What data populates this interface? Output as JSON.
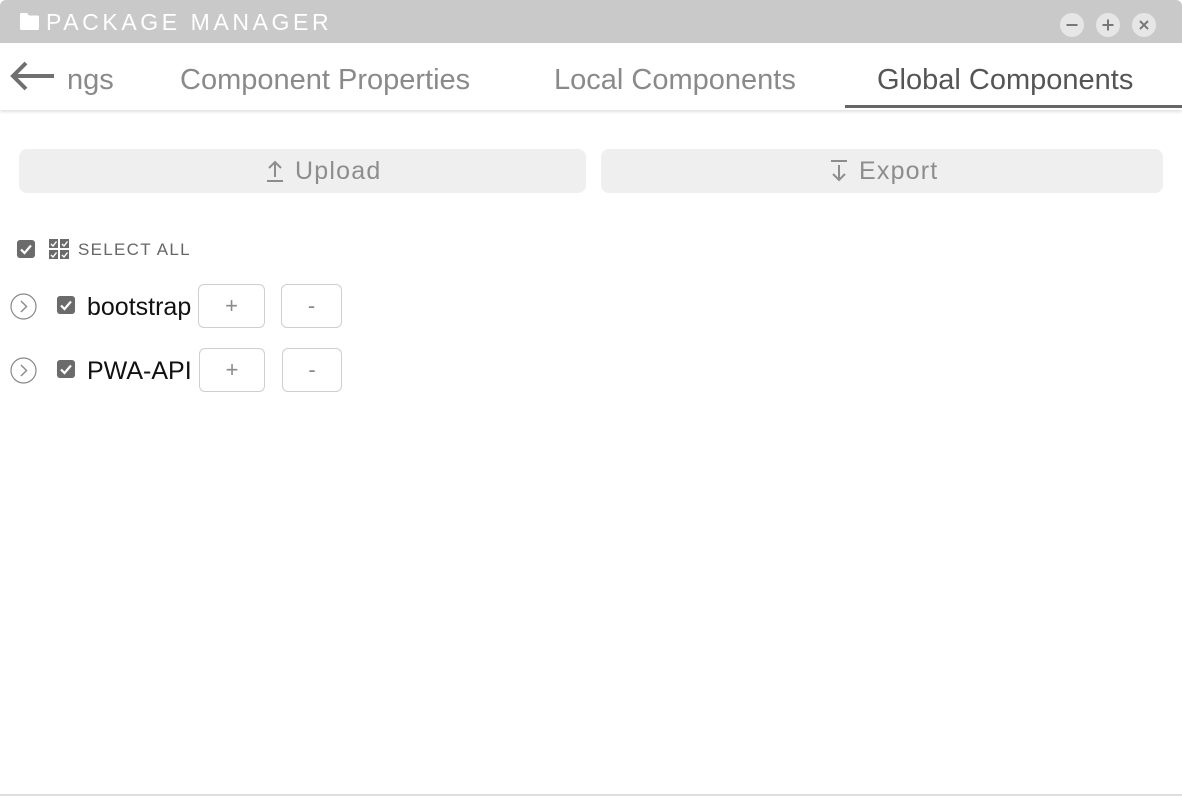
{
  "window": {
    "title": "PACKAGE MANAGER",
    "icon": "folder-icon",
    "controls": [
      "minimize-icon",
      "maximize-icon",
      "close-icon"
    ]
  },
  "tabs": {
    "back_icon": "back-arrow-icon",
    "items": [
      {
        "label": "ngs",
        "active": false
      },
      {
        "label": "Component Properties",
        "active": false
      },
      {
        "label": "Local Components",
        "active": false
      },
      {
        "label": "Global Components",
        "active": true
      }
    ]
  },
  "actions": {
    "upload_label": "Upload",
    "upload_icon": "upload-icon",
    "export_label": "Export",
    "export_icon": "export-icon"
  },
  "select_all": {
    "label": "SELECT ALL",
    "checked": true,
    "icon": "select-all-icon"
  },
  "packages": [
    {
      "name": "bootstrap",
      "checked": true,
      "plus_label": "+",
      "minus_label": "-"
    },
    {
      "name": "PWA-API",
      "checked": true,
      "plus_label": "+",
      "minus_label": "-"
    }
  ],
  "colors": {
    "titlebar": "#c9c9c9",
    "active_tab": "#555555",
    "inactive_tab": "#8a8a8a",
    "checkbox": "#6b6b6b",
    "button_bg": "#efefef"
  }
}
